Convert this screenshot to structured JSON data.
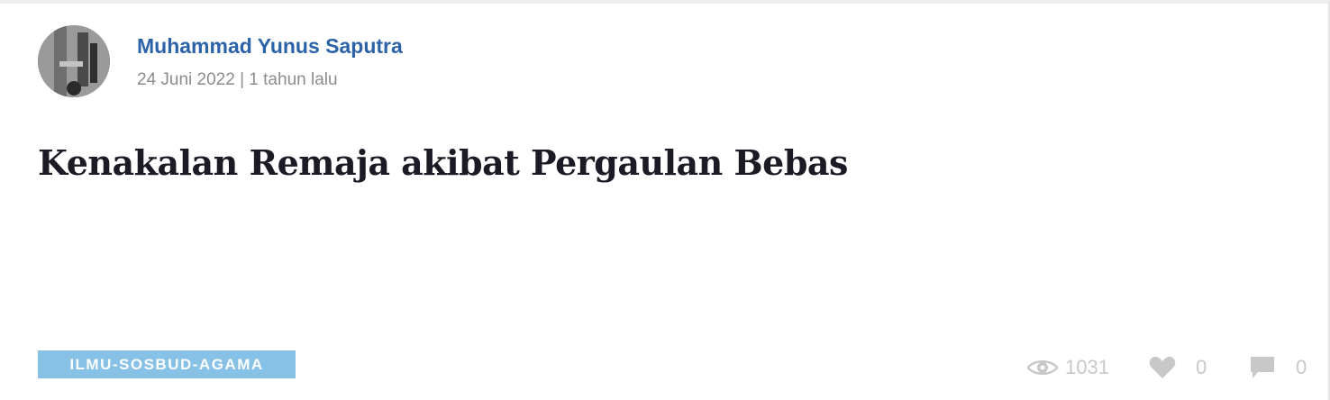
{
  "post": {
    "author_name": "Muhammad Yunus Saputra",
    "meta": "24 Juni 2022 | 1 tahun lalu",
    "title": "Kenakalan Remaja akibat Pergaulan Bebas",
    "category_tag": "ILMU-SOSBUD-AGAMA"
  },
  "stats": {
    "views": "1031",
    "likes": "0",
    "comments": "0",
    "views_icon": "eye-icon",
    "likes_icon": "heart-icon",
    "comments_icon": "comment-icon"
  },
  "colors": {
    "author": "#2c63a8",
    "tag_bg": "#87c1e6",
    "stat_gray": "#c8c8c8"
  }
}
